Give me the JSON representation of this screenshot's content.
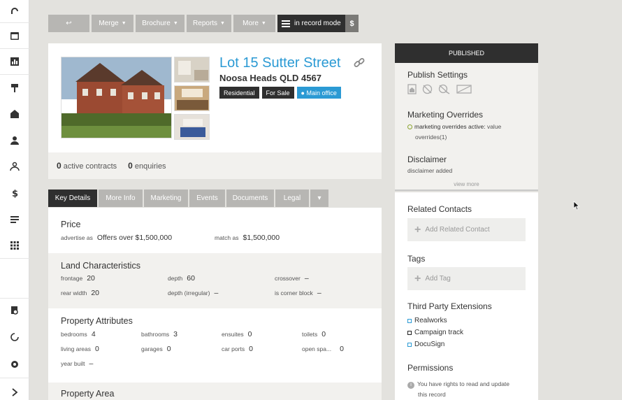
{
  "toolbar": {
    "back_label": "↩",
    "merge_label": "Merge",
    "brochure_label": "Brochure",
    "reports_label": "Reports",
    "more_label": "More",
    "record_mode_label": "in record mode",
    "dollar_label": "$"
  },
  "listing": {
    "address": "Lot 15 Sutter Street",
    "suburb": "Noosa Heads QLD 4567",
    "badges": [
      "Residential",
      "For Sale",
      "Main office"
    ],
    "active_contracts": "0",
    "active_contracts_label": "active contracts",
    "enquiries": "0",
    "enquiries_label": "enquiries"
  },
  "tabs": [
    "Key Details",
    "More Info",
    "Marketing",
    "Events",
    "Documents",
    "Legal",
    "▾"
  ],
  "price": {
    "title": "Price",
    "advertise_as_label": "advertise as",
    "advertise_as_value": "Offers over $1,500,000",
    "match_as_label": "match as",
    "match_as_value": "$1,500,000"
  },
  "land": {
    "title": "Land Characteristics",
    "frontage_label": "frontage",
    "frontage_value": "20",
    "depth_label": "depth",
    "depth_value": "60",
    "crossover_label": "crossover",
    "crossover_value": "–",
    "rear_width_label": "rear width",
    "rear_width_value": "20",
    "depth_irregular_label": "depth (irregular)",
    "depth_irregular_value": "–",
    "corner_block_label": "is corner block",
    "corner_block_value": "–"
  },
  "attributes": {
    "title": "Property Attributes",
    "bedrooms_label": "bedrooms",
    "bedrooms_value": "4",
    "bathrooms_label": "bathrooms",
    "bathrooms_value": "3",
    "ensuites_label": "ensuites",
    "ensuites_value": "0",
    "toilets_label": "toilets",
    "toilets_value": "0",
    "living_label": "living areas",
    "living_value": "0",
    "garages_label": "garages",
    "garages_value": "0",
    "carports_label": "car ports",
    "carports_value": "0",
    "openspaces_label": "open spa...",
    "openspaces_value": "0",
    "year_built_label": "year built",
    "year_built_value": "–"
  },
  "area": {
    "title": "Property Area"
  },
  "right_panel": {
    "status": "PUBLISHED",
    "publish_settings_title": "Publish Settings",
    "marketing_overrides_title": "Marketing Overrides",
    "marketing_overrides_text": "marketing overrides active:",
    "marketing_overrides_value": "value",
    "marketing_overrides_line2": "overrides(1)",
    "disclaimer_title": "Disclaimer",
    "disclaimer_text": "disclaimer added",
    "view_more": "view more",
    "related_contacts_title": "Related Contacts",
    "add_related_contact": "Add Related Contact",
    "tags_title": "Tags",
    "add_tag": "Add Tag",
    "third_party_title": "Third Party Extensions",
    "extensions": [
      "Realworks",
      "Campaign track",
      "DocuSign"
    ],
    "permissions_title": "Permissions",
    "permissions_line1": "You have rights to read and update",
    "permissions_line2": "this record"
  },
  "colors": {
    "accent": "#2b9ad4",
    "dark": "#2f2f2f",
    "button_grey": "#b7b6b3",
    "override_green": "#8aa32e"
  }
}
